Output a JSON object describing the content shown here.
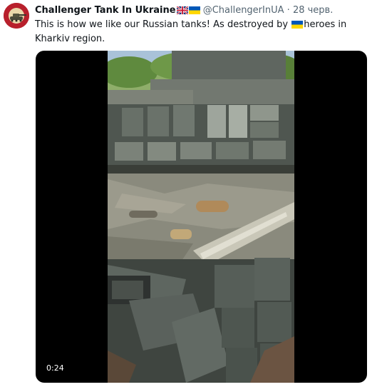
{
  "tweet": {
    "author_name": "Challenger Tank In Ukraine",
    "author_handle": "@ChallengerInUA",
    "separator": "·",
    "date": "28 черв.",
    "text_part1": "This is how we like our Russian tanks! As destroyed by ",
    "text_part2": "heroes in Kharkiv region.",
    "name_flags": [
      "uk-flag-icon",
      "ukraine-flag-icon"
    ],
    "inline_flag": "ukraine-flag-icon"
  },
  "media": {
    "type": "video",
    "timecode": "0:24"
  },
  "colors": {
    "ukraine_blue": "#0057b7",
    "ukraine_yellow": "#ffd700",
    "secondary_text": "#536471",
    "avatar_red": "#b8202c"
  }
}
